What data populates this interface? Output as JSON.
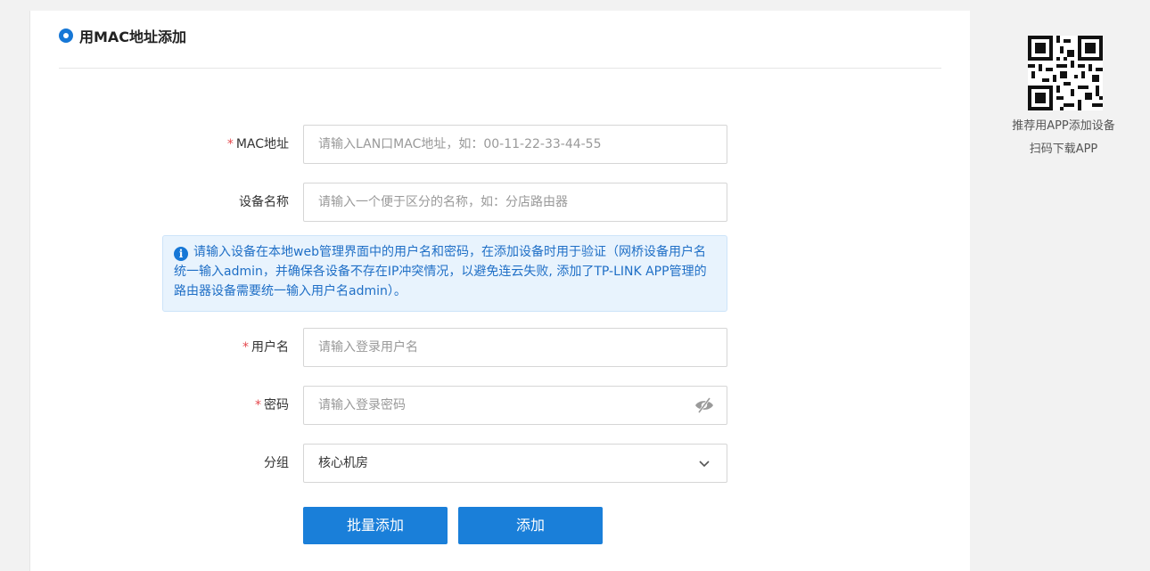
{
  "section": {
    "title": "用MAC地址添加"
  },
  "form": {
    "mac": {
      "label": "MAC地址",
      "required": "*",
      "placeholder": "请输入LAN口MAC地址，如：00-11-22-33-44-55"
    },
    "device_name": {
      "label": "设备名称",
      "placeholder": "请输入一个便于区分的名称，如：分店路由器"
    },
    "info": {
      "icon": "info-icon",
      "text": "请输入设备在本地web管理界面中的用户名和密码，在添加设备时用于验证（网桥设备用户名统一输入admin，并确保各设备不存在IP冲突情况，以避免连云失败, 添加了TP-LINK APP管理的路由器设备需要统一输入用户名admin）。"
    },
    "username": {
      "label": "用户名",
      "required": "*",
      "placeholder": "请输入登录用户名"
    },
    "password": {
      "label": "密码",
      "required": "*",
      "placeholder": "请输入登录密码",
      "icon": "eye-off-icon"
    },
    "group": {
      "label": "分组",
      "value": "核心机房",
      "icon": "chevron-down-icon"
    }
  },
  "buttons": {
    "batch_add": "批量添加",
    "add": "添加"
  },
  "side": {
    "qr_icon": "qr-code-icon",
    "line1": "推荐用APP添加设备",
    "line2": "扫码下载APP"
  },
  "colors": {
    "accent": "#1a7fd9",
    "required": "#e5484d",
    "info_bg": "#e8f3fd",
    "info_text": "#1f6fc6"
  }
}
